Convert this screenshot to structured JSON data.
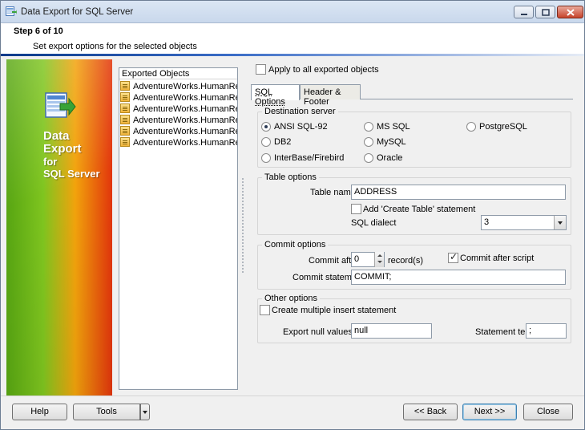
{
  "window": {
    "title": "Data Export for SQL Server"
  },
  "header": {
    "step": "Step 6 of 10",
    "description": "Set export options for the selected objects"
  },
  "banner": {
    "line1": "Data",
    "line2": "Export",
    "line3": "for",
    "line4": "SQL Server"
  },
  "objects": {
    "header": "Exported Objects",
    "items": [
      "AdventureWorks.HumanResources",
      "AdventureWorks.HumanResources",
      "AdventureWorks.HumanResources",
      "AdventureWorks.HumanResources",
      "AdventureWorks.HumanResources",
      "AdventureWorks.HumanResources"
    ]
  },
  "apply_all": {
    "label": "Apply to all exported objects",
    "checked": false
  },
  "tabs": [
    {
      "label": "SQL Options",
      "active": true
    },
    {
      "label": "Header & Footer",
      "active": false
    }
  ],
  "destination": {
    "title": "Destination server",
    "options": [
      {
        "label": "ANSI SQL-92",
        "checked": true
      },
      {
        "label": "MS SQL",
        "checked": false
      },
      {
        "label": "PostgreSQL",
        "checked": false
      },
      {
        "label": "DB2",
        "checked": false
      },
      {
        "label": "MySQL",
        "checked": false
      },
      {
        "label": "InterBase/Firebird",
        "checked": false
      },
      {
        "label": "Oracle",
        "checked": false
      }
    ]
  },
  "table_options": {
    "title": "Table options",
    "table_name_label": "Table name",
    "table_name_value": "ADDRESS",
    "create_table_label": "Add 'Create Table' statement",
    "create_table_checked": false,
    "sql_dialect_label": "SQL dialect",
    "sql_dialect_value": "3"
  },
  "commit_options": {
    "title": "Commit options",
    "commit_after_label": "Commit after",
    "commit_after_value": "0",
    "records_label": "record(s)",
    "commit_after_script_label": "Commit after script",
    "commit_after_script_checked": true,
    "commit_statement_label": "Commit statement",
    "commit_statement_value": "COMMIT;"
  },
  "other_options": {
    "title": "Other options",
    "multiple_insert_label": "Create multiple insert statement",
    "multiple_insert_checked": false,
    "null_values_label": "Export null values as",
    "null_values_value": "null",
    "statement_term_label": "Statement term",
    "statement_term_value": ";"
  },
  "buttons": {
    "help": "Help",
    "tools": "Tools",
    "back": "<< Back",
    "next": "Next >>",
    "close": "Close"
  },
  "colors": {
    "header_accent": "#0b3a8a",
    "banner_green": "#57a512",
    "banner_orange": "#f2a30c",
    "banner_red": "#e2350c"
  }
}
